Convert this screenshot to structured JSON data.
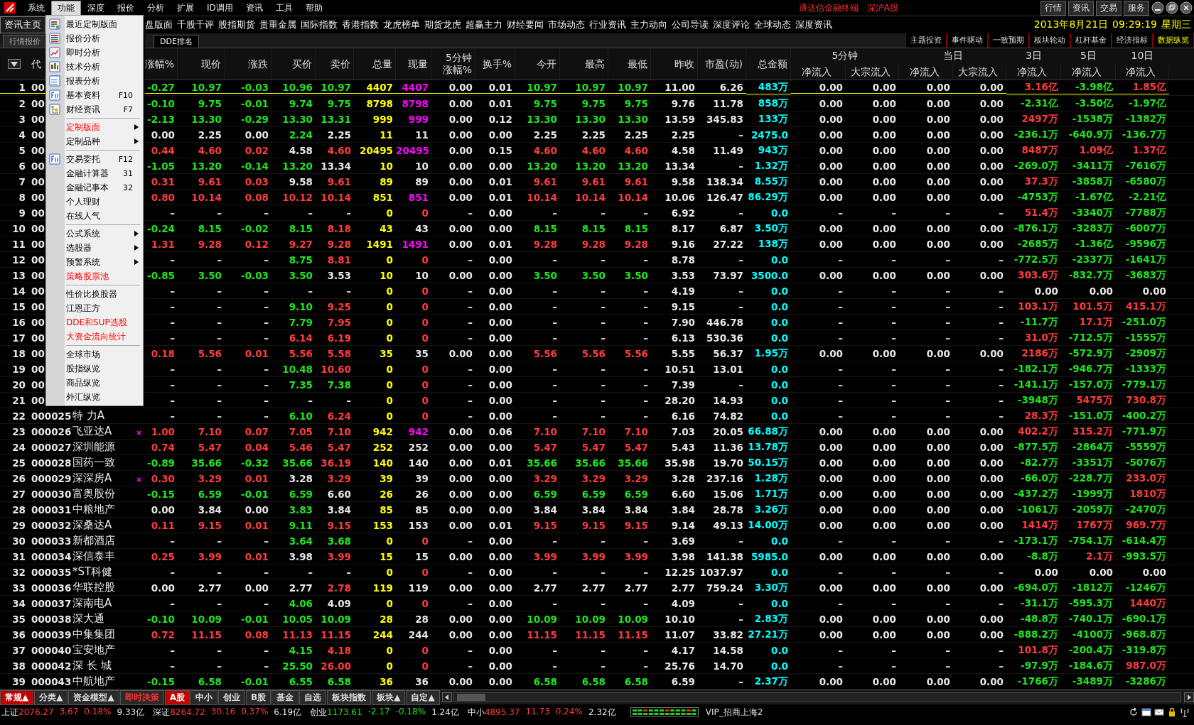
{
  "menubar": {
    "items": [
      {
        "label": "系统",
        "selected": false
      },
      {
        "label": "功能",
        "selected": true
      },
      {
        "label": "深度",
        "selected": false
      },
      {
        "label": "报价",
        "selected": false
      },
      {
        "label": "分析",
        "selected": false
      },
      {
        "label": "扩展",
        "selected": false
      },
      {
        "label": "ID调用",
        "selected": false
      },
      {
        "label": "资讯",
        "selected": false
      },
      {
        "label": "工具",
        "selected": false
      },
      {
        "label": "帮助",
        "selected": false
      }
    ],
    "title": "通达信金融终端",
    "market": "深沪A股",
    "buttons": [
      "行情",
      "资讯",
      "交易",
      "服务"
    ]
  },
  "linkbar": {
    "home_tab": "资讯主页",
    "links": [
      "盘版面",
      "千股千评",
      "股指期货",
      "贵重金属",
      "国际指数",
      "香港指数",
      "龙虎榜单",
      "期货龙虎",
      "超赢主力",
      "财经要闻",
      "市场动态",
      "行业资讯",
      "主力动向",
      "公司导读",
      "深度评论",
      "全球动态",
      "深度资讯"
    ],
    "date": "2013年8月21日",
    "time": "09:29:19",
    "weekday": "星期三"
  },
  "tabbar": {
    "tabs": [
      {
        "label": "行情报价",
        "selected": false
      },
      {
        "label": "DDE排名",
        "selected": true
      }
    ],
    "buttons": [
      {
        "label": "主题投资",
        "selected": false
      },
      {
        "label": "事件驱动",
        "selected": false
      },
      {
        "label": "一致预期",
        "selected": false
      },
      {
        "label": "板块轮动",
        "selected": false
      },
      {
        "label": "杠杆基金",
        "selected": false
      },
      {
        "label": "经济指标",
        "selected": false
      },
      {
        "label": "数据纵览",
        "selected": true
      }
    ]
  },
  "menu": {
    "sections": [
      [
        {
          "label": "最近定制版面",
          "highlight": false,
          "submenu": false
        },
        {
          "label": "报价分析",
          "highlight": false,
          "submenu": false
        },
        {
          "label": "即时分析",
          "highlight": false,
          "submenu": false
        },
        {
          "label": "技术分析",
          "highlight": false,
          "submenu": false
        },
        {
          "label": "报表分析",
          "highlight": false,
          "submenu": false
        },
        {
          "label": "基本资料",
          "shortcut": "F10",
          "highlight": false,
          "submenu": false
        },
        {
          "label": "财经资讯",
          "shortcut": "F7",
          "highlight": false,
          "submenu": false
        }
      ],
      [
        {
          "label": "定制版面",
          "highlight": true,
          "submenu": true
        },
        {
          "label": "定制品种",
          "highlight": false,
          "submenu": true
        }
      ],
      [
        {
          "label": "交易委托",
          "shortcut": "F12",
          "highlight": false,
          "submenu": false
        },
        {
          "label": "金融计算器",
          "shortcut": "31",
          "highlight": false,
          "submenu": false
        },
        {
          "label": "金融记事本",
          "shortcut": "32",
          "highlight": false,
          "submenu": false
        },
        {
          "label": "个人理财",
          "highlight": false,
          "submenu": false
        },
        {
          "label": "在线人气",
          "highlight": false,
          "submenu": false
        }
      ],
      [
        {
          "label": "公式系统",
          "highlight": false,
          "submenu": true
        },
        {
          "label": "选股器",
          "highlight": false,
          "submenu": true
        },
        {
          "label": "预警系统",
          "highlight": false,
          "submenu": true
        },
        {
          "label": "策略股票池",
          "highlight": true,
          "submenu": false
        }
      ],
      [
        {
          "label": "性价比换股器",
          "highlight": false,
          "submenu": false
        },
        {
          "label": "江恩正方",
          "highlight": false,
          "submenu": false
        },
        {
          "label": "DDE和SUP选股",
          "highlight": true,
          "submenu": false
        },
        {
          "label": "大资金流向统计",
          "highlight": true,
          "submenu": false
        }
      ],
      [
        {
          "label": "全球市场",
          "highlight": false,
          "submenu": false
        },
        {
          "label": "股指纵览",
          "highlight": false,
          "submenu": false
        },
        {
          "label": "商品纵览",
          "highlight": false,
          "submenu": false
        },
        {
          "label": "外汇纵览",
          "highlight": false,
          "submenu": false
        }
      ]
    ]
  },
  "table": {
    "code_header": "代",
    "columns": [
      {
        "lines": [
          "涨幅%"
        ]
      },
      {
        "lines": [
          "现价"
        ]
      },
      {
        "lines": [
          "涨跌"
        ]
      },
      {
        "lines": [
          "买价"
        ]
      },
      {
        "lines": [
          "卖价"
        ]
      },
      {
        "lines": [
          "总量"
        ]
      },
      {
        "lines": [
          "现量"
        ]
      },
      {
        "lines": [
          "5分钟",
          "涨幅%"
        ]
      },
      {
        "lines": [
          "换手%"
        ]
      },
      {
        "lines": [
          "今开"
        ]
      },
      {
        "lines": [
          "最高"
        ]
      },
      {
        "lines": [
          "最低"
        ]
      },
      {
        "lines": [
          "昨收"
        ]
      },
      {
        "lines": [
          "市盈(动)"
        ]
      },
      {
        "lines": [
          "总金额"
        ]
      },
      {
        "group": "5分钟",
        "lines": [
          "净流入"
        ]
      },
      {
        "in_group": true,
        "lines": [
          "大宗流入"
        ]
      },
      {
        "group": "当日",
        "lines": [
          "净流入"
        ]
      },
      {
        "in_group": true,
        "lines": [
          "大宗流入"
        ]
      },
      {
        "group": "3日",
        "lines": [
          "净流入"
        ]
      },
      {
        "group": "5日",
        "lines": [
          "净流入"
        ]
      },
      {
        "group": "10日",
        "lines": [
          "净流入"
        ]
      }
    ],
    "rows": [
      {
        "no": "1",
        "code": "00",
        "selected": true,
        "big_buy": true,
        "cells": [
          "-0.27",
          "10.97",
          "-0.03",
          "10.96",
          "10.97",
          "4407",
          "4407",
          "0.00",
          "0.01",
          "10.97",
          "10.97",
          "10.97",
          "11.00",
          "6.26",
          "483万",
          "0.00",
          "0.00",
          "0.00",
          "0.00",
          "3.16亿",
          "-3.98亿",
          "1.85亿"
        ]
      },
      {
        "no": "2",
        "code": "00",
        "selected": false,
        "big_buy": true,
        "cells": [
          "-0.10",
          "9.75",
          "-0.01",
          "9.74",
          "9.75",
          "8798",
          "8798",
          "0.00",
          "0.01",
          "9.75",
          "9.75",
          "9.75",
          "9.76",
          "11.78",
          "858万",
          "0.00",
          "0.00",
          "0.00",
          "0.00",
          "-2.31亿",
          "-3.50亿",
          "-1.97亿"
        ]
      },
      {
        "no": "3",
        "code": "00",
        "selected": false,
        "big_buy": true,
        "cells": [
          "-2.13",
          "13.30",
          "-0.29",
          "13.30",
          "13.31",
          "999",
          "999",
          "0.00",
          "0.12",
          "13.30",
          "13.30",
          "13.30",
          "13.59",
          "345.83",
          "133万",
          "0.00",
          "0.00",
          "0.00",
          "0.00",
          "2497万",
          "-1538万",
          "-1382万"
        ]
      },
      {
        "no": "4",
        "code": "00",
        "selected": false,
        "big_buy": false,
        "cells": [
          "0.00",
          "2.25",
          "0.00",
          "2.24",
          "2.25",
          "11",
          "11",
          "0.00",
          "0.00",
          "2.25",
          "2.25",
          "2.25",
          "2.25",
          "–",
          "2475.0",
          "0.00",
          "0.00",
          "0.00",
          "0.00",
          "-236.1万",
          "-640.9万",
          "-136.7万"
        ]
      },
      {
        "no": "5",
        "code": "00",
        "selected": false,
        "big_buy": true,
        "cells": [
          "0.44",
          "4.60",
          "0.02",
          "4.58",
          "4.60",
          "20495",
          "20495",
          "0.00",
          "0.15",
          "4.60",
          "4.60",
          "4.60",
          "4.58",
          "11.49",
          "943万",
          "0.00",
          "0.00",
          "0.00",
          "0.00",
          "8487万",
          "1.09亿",
          "1.37亿"
        ]
      },
      {
        "no": "6",
        "code": "00",
        "selected": false,
        "big_buy": false,
        "cells": [
          "-1.05",
          "13.20",
          "-0.14",
          "13.20",
          "13.34",
          "10",
          "10",
          "0.00",
          "0.00",
          "13.20",
          "13.20",
          "13.20",
          "13.34",
          "–",
          "1.32万",
          "0.00",
          "0.00",
          "0.00",
          "0.00",
          "-269.0万",
          "-3411万",
          "-7616万"
        ]
      },
      {
        "no": "7",
        "code": "00",
        "selected": false,
        "big_buy": false,
        "cells": [
          "0.31",
          "9.61",
          "0.03",
          "9.58",
          "9.61",
          "89",
          "89",
          "0.00",
          "0.01",
          "9.61",
          "9.61",
          "9.61",
          "9.58",
          "138.34",
          "8.55万",
          "0.00",
          "0.00",
          "0.00",
          "0.00",
          "37.3万",
          "-3858万",
          "-6580万"
        ]
      },
      {
        "no": "8",
        "code": "00",
        "selected": false,
        "big_buy": true,
        "cells": [
          "0.80",
          "10.14",
          "0.08",
          "10.12",
          "10.14",
          "851",
          "851",
          "0.00",
          "0.01",
          "10.14",
          "10.14",
          "10.14",
          "10.06",
          "126.47",
          "86.29万",
          "0.00",
          "0.00",
          "0.00",
          "0.00",
          "-4753万",
          "-1.67亿",
          "-2.21亿"
        ]
      },
      {
        "no": "9",
        "code": "00",
        "selected": false,
        "big_buy": false,
        "cells": [
          "–",
          "–",
          "–",
          "–",
          "–",
          "0",
          "0",
          "–",
          "0.00",
          "–",
          "–",
          "–",
          "6.92",
          "–",
          "0.0",
          "–",
          "–",
          "–",
          "–",
          "51.4万",
          "-3340万",
          "-7788万"
        ]
      },
      {
        "no": "10",
        "code": "00",
        "selected": false,
        "big_buy": false,
        "cells": [
          "-0.24",
          "8.15",
          "-0.02",
          "8.15",
          "8.18",
          "43",
          "43",
          "0.00",
          "0.00",
          "8.15",
          "8.15",
          "8.15",
          "8.17",
          "6.87",
          "3.50万",
          "0.00",
          "0.00",
          "0.00",
          "0.00",
          "-876.1万",
          "-3283万",
          "-6007万"
        ]
      },
      {
        "no": "11",
        "code": "00",
        "selected": false,
        "big_buy": true,
        "cells": [
          "1.31",
          "9.28",
          "0.12",
          "9.27",
          "9.28",
          "1491",
          "1491",
          "0.00",
          "0.01",
          "9.28",
          "9.28",
          "9.28",
          "9.16",
          "27.22",
          "138万",
          "0.00",
          "0.00",
          "0.00",
          "0.00",
          "-2685万",
          "-1.36亿",
          "-9596万"
        ]
      },
      {
        "no": "12",
        "code": "00",
        "selected": false,
        "big_buy": false,
        "cells": [
          "–",
          "–",
          "–",
          "8.75",
          "8.81",
          "0",
          "0",
          "–",
          "0.00",
          "–",
          "–",
          "–",
          "8.78",
          "–",
          "0.0",
          "–",
          "–",
          "–",
          "–",
          "-772.5万",
          "-2337万",
          "-1641万"
        ]
      },
      {
        "no": "13",
        "code": "00",
        "selected": false,
        "big_buy": false,
        "cells": [
          "-0.85",
          "3.50",
          "-0.03",
          "3.50",
          "3.53",
          "10",
          "10",
          "0.00",
          "0.00",
          "3.50",
          "3.50",
          "3.50",
          "3.53",
          "73.97",
          "3500.0",
          "0.00",
          "0.00",
          "0.00",
          "0.00",
          "303.6万",
          "-832.7万",
          "-3683万"
        ]
      },
      {
        "no": "14",
        "code": "00",
        "selected": false,
        "big_buy": false,
        "cells": [
          "–",
          "–",
          "–",
          "–",
          "–",
          "0",
          "0",
          "–",
          "0.00",
          "–",
          "–",
          "–",
          "4.19",
          "–",
          "0.0",
          "–",
          "–",
          "–",
          "–",
          "0.00",
          "0.00",
          "0.00"
        ]
      },
      {
        "no": "15",
        "code": "00",
        "selected": false,
        "big_buy": false,
        "cells": [
          "–",
          "–",
          "–",
          "9.10",
          "9.25",
          "0",
          "0",
          "–",
          "0.00",
          "–",
          "–",
          "–",
          "9.15",
          "–",
          "0.0",
          "–",
          "–",
          "–",
          "–",
          "103.1万",
          "101.5万",
          "415.1万"
        ]
      },
      {
        "no": "16",
        "code": "00",
        "selected": false,
        "big_buy": false,
        "cells": [
          "–",
          "–",
          "–",
          "7.79",
          "7.95",
          "0",
          "0",
          "–",
          "0.00",
          "–",
          "–",
          "–",
          "7.90",
          "446.78",
          "0.0",
          "–",
          "–",
          "–",
          "–",
          "-11.7万",
          "17.1万",
          "-251.0万"
        ]
      },
      {
        "no": "17",
        "code": "00",
        "selected": false,
        "big_buy": false,
        "cells": [
          "–",
          "–",
          "–",
          "6.14",
          "6.19",
          "0",
          "0",
          "–",
          "0.00",
          "–",
          "–",
          "–",
          "6.13",
          "530.36",
          "0.0",
          "–",
          "–",
          "–",
          "–",
          "31.0万",
          "-712.5万",
          "-1555万"
        ]
      },
      {
        "no": "18",
        "code": "00",
        "selected": false,
        "big_buy": false,
        "cells": [
          "0.18",
          "5.56",
          "0.01",
          "5.56",
          "5.58",
          "35",
          "35",
          "0.00",
          "0.00",
          "5.56",
          "5.56",
          "5.56",
          "5.55",
          "56.37",
          "1.95万",
          "0.00",
          "0.00",
          "0.00",
          "0.00",
          "2186万",
          "-572.9万",
          "-2909万"
        ]
      },
      {
        "no": "19",
        "code": "00",
        "selected": false,
        "big_buy": false,
        "cells": [
          "–",
          "–",
          "–",
          "10.48",
          "10.60",
          "0",
          "0",
          "–",
          "0.00",
          "–",
          "–",
          "–",
          "10.51",
          "13.01",
          "0.0",
          "–",
          "–",
          "–",
          "–",
          "-182.1万",
          "-946.7万",
          "-1333万"
        ]
      },
      {
        "no": "20",
        "code": "00",
        "selected": false,
        "big_buy": false,
        "cells": [
          "–",
          "–",
          "–",
          "7.35",
          "7.38",
          "0",
          "0",
          "–",
          "0.00",
          "–",
          "–",
          "–",
          "7.39",
          "–",
          "0.0",
          "–",
          "–",
          "–",
          "–",
          "-141.1万",
          "-157.0万",
          "-779.1万"
        ]
      },
      {
        "no": "21",
        "code": "00",
        "selected": false,
        "big_buy": false,
        "cells": [
          "–",
          "–",
          "–",
          "–",
          "–",
          "0",
          "0",
          "–",
          "0.00",
          "–",
          "–",
          "–",
          "28.20",
          "14.93",
          "0.0",
          "–",
          "–",
          "–",
          "–",
          "-3948万",
          "5475万",
          "730.8万"
        ]
      },
      {
        "no": "22",
        "code": "000025",
        "name": "特 力A",
        "selected": false,
        "big_buy": false,
        "marked": false,
        "cells": [
          "–",
          "–",
          "–",
          "6.10",
          "6.24",
          "0",
          "0",
          "–",
          "0.00",
          "–",
          "–",
          "–",
          "6.16",
          "74.82",
          "0.0",
          "–",
          "–",
          "–",
          "–",
          "28.3万",
          "-151.0万",
          "-400.2万"
        ]
      },
      {
        "no": "23",
        "code": "000026",
        "name": "飞亚达A",
        "selected": false,
        "big_buy": true,
        "marked": true,
        "cells": [
          "1.00",
          "7.10",
          "0.07",
          "7.05",
          "7.10",
          "942",
          "942",
          "0.00",
          "0.06",
          "7.10",
          "7.10",
          "7.10",
          "7.03",
          "20.05",
          "66.88万",
          "0.00",
          "0.00",
          "0.00",
          "0.00",
          "402.2万",
          "315.2万",
          "-771.9万"
        ]
      },
      {
        "no": "24",
        "code": "000027",
        "name": "深圳能源",
        "selected": false,
        "big_buy": false,
        "marked": false,
        "cells": [
          "0.74",
          "5.47",
          "0.04",
          "5.46",
          "5.47",
          "252",
          "252",
          "0.00",
          "0.00",
          "5.47",
          "5.47",
          "5.47",
          "5.43",
          "11.36",
          "13.78万",
          "0.00",
          "0.00",
          "0.00",
          "0.00",
          "-877.5万",
          "-2864万",
          "-5559万"
        ]
      },
      {
        "no": "25",
        "code": "000028",
        "name": "国药一致",
        "selected": false,
        "big_buy": false,
        "marked": false,
        "cells": [
          "-0.89",
          "35.66",
          "-0.32",
          "35.66",
          "36.19",
          "140",
          "140",
          "0.00",
          "0.01",
          "35.66",
          "35.66",
          "35.66",
          "35.98",
          "19.70",
          "50.15万",
          "0.00",
          "0.00",
          "0.00",
          "0.00",
          "-82.7万",
          "-3351万",
          "-5076万"
        ]
      },
      {
        "no": "26",
        "code": "000029",
        "name": "深深房A",
        "selected": false,
        "big_buy": false,
        "marked": true,
        "cells": [
          "0.30",
          "3.29",
          "0.01",
          "3.28",
          "3.29",
          "39",
          "39",
          "0.00",
          "0.00",
          "3.29",
          "3.29",
          "3.29",
          "3.28",
          "237.16",
          "1.28万",
          "0.00",
          "0.00",
          "0.00",
          "0.00",
          "-66.0万",
          "-228.7万",
          "233.0万"
        ]
      },
      {
        "no": "27",
        "code": "000030",
        "name": "富奥股份",
        "selected": false,
        "big_buy": false,
        "marked": false,
        "cells": [
          "-0.15",
          "6.59",
          "-0.01",
          "6.59",
          "6.60",
          "26",
          "26",
          "0.00",
          "0.00",
          "6.59",
          "6.59",
          "6.59",
          "6.60",
          "15.06",
          "1.71万",
          "0.00",
          "0.00",
          "0.00",
          "0.00",
          "-437.2万",
          "-1999万",
          "1810万"
        ]
      },
      {
        "no": "28",
        "code": "000031",
        "name": "中粮地产",
        "selected": false,
        "big_buy": false,
        "marked": false,
        "cells": [
          "0.00",
          "3.84",
          "0.00",
          "3.83",
          "3.84",
          "85",
          "85",
          "0.00",
          "0.00",
          "3.84",
          "3.84",
          "3.84",
          "3.84",
          "28.78",
          "3.26万",
          "0.00",
          "0.00",
          "0.00",
          "0.00",
          "-1061万",
          "-2059万",
          "-2470万"
        ]
      },
      {
        "no": "29",
        "code": "000032",
        "name": "深桑达A",
        "selected": false,
        "big_buy": false,
        "marked": false,
        "cells": [
          "0.11",
          "9.15",
          "0.01",
          "9.11",
          "9.15",
          "153",
          "153",
          "0.00",
          "0.01",
          "9.15",
          "9.15",
          "9.15",
          "9.14",
          "49.13",
          "14.00万",
          "0.00",
          "0.00",
          "0.00",
          "0.00",
          "1414万",
          "1767万",
          "969.7万"
        ]
      },
      {
        "no": "30",
        "code": "000033",
        "name": "新都酒店",
        "selected": false,
        "big_buy": false,
        "marked": false,
        "cells": [
          "–",
          "–",
          "–",
          "3.64",
          "3.68",
          "0",
          "0",
          "–",
          "0.00",
          "–",
          "–",
          "–",
          "3.69",
          "–",
          "0.0",
          "–",
          "–",
          "–",
          "–",
          "-173.1万",
          "-754.1万",
          "-614.4万"
        ]
      },
      {
        "no": "31",
        "code": "000034",
        "name": "深信泰丰",
        "selected": false,
        "big_buy": false,
        "marked": false,
        "cells": [
          "0.25",
          "3.99",
          "0.01",
          "3.98",
          "3.99",
          "15",
          "15",
          "0.00",
          "0.00",
          "3.99",
          "3.99",
          "3.99",
          "3.98",
          "141.38",
          "5985.0",
          "0.00",
          "0.00",
          "0.00",
          "0.00",
          "-8.8万",
          "2.1万",
          "-993.5万"
        ]
      },
      {
        "no": "32",
        "code": "000035",
        "name": "*ST科健",
        "selected": false,
        "big_buy": false,
        "marked": false,
        "cells": [
          "–",
          "–",
          "–",
          "–",
          "–",
          "0",
          "0",
          "–",
          "0.00",
          "–",
          "–",
          "–",
          "12.25",
          "1037.97",
          "0.0",
          "–",
          "–",
          "–",
          "–",
          "0.00",
          "0.00",
          "0.00"
        ]
      },
      {
        "no": "33",
        "code": "000036",
        "name": "华联控股",
        "selected": false,
        "big_buy": false,
        "marked": false,
        "cells": [
          "0.00",
          "2.77",
          "0.00",
          "2.77",
          "2.78",
          "119",
          "119",
          "0.00",
          "0.00",
          "2.77",
          "2.77",
          "2.77",
          "2.77",
          "759.24",
          "3.30万",
          "0.00",
          "0.00",
          "0.00",
          "0.00",
          "-694.0万",
          "-1812万",
          "-1246万"
        ]
      },
      {
        "no": "34",
        "code": "000037",
        "name": "深南电A",
        "selected": false,
        "big_buy": false,
        "marked": false,
        "cells": [
          "–",
          "–",
          "–",
          "4.06",
          "4.09",
          "0",
          "0",
          "–",
          "0.00",
          "–",
          "–",
          "–",
          "4.09",
          "–",
          "0.0",
          "–",
          "–",
          "–",
          "–",
          "-31.1万",
          "-595.3万",
          "1440万"
        ]
      },
      {
        "no": "35",
        "code": "000038",
        "name": "深大通",
        "selected": false,
        "big_buy": false,
        "marked": false,
        "cells": [
          "-0.10",
          "10.09",
          "-0.01",
          "10.05",
          "10.09",
          "28",
          "28",
          "0.00",
          "0.00",
          "10.09",
          "10.09",
          "10.09",
          "10.10",
          "–",
          "2.83万",
          "0.00",
          "0.00",
          "0.00",
          "0.00",
          "-48.8万",
          "-740.1万",
          "-690.1万"
        ]
      },
      {
        "no": "36",
        "code": "000039",
        "name": "中集集团",
        "selected": false,
        "big_buy": false,
        "marked": false,
        "cells": [
          "0.72",
          "11.15",
          "0.08",
          "11.13",
          "11.15",
          "244",
          "244",
          "0.00",
          "0.00",
          "11.15",
          "11.15",
          "11.15",
          "11.07",
          "33.82",
          "27.21万",
          "0.00",
          "0.00",
          "0.00",
          "0.00",
          "-888.2万",
          "-4100万",
          "-968.8万"
        ]
      },
      {
        "no": "37",
        "code": "000040",
        "name": "宝安地产",
        "selected": false,
        "big_buy": false,
        "marked": false,
        "cells": [
          "–",
          "–",
          "–",
          "4.15",
          "4.18",
          "0",
          "0",
          "–",
          "0.00",
          "–",
          "–",
          "–",
          "4.17",
          "14.58",
          "0.0",
          "–",
          "–",
          "–",
          "–",
          "101.8万",
          "-200.4万",
          "-319.8万"
        ]
      },
      {
        "no": "38",
        "code": "000042",
        "name": "深 长 城",
        "selected": false,
        "big_buy": false,
        "marked": false,
        "cells": [
          "–",
          "–",
          "–",
          "25.50",
          "26.00",
          "0",
          "0",
          "–",
          "0.00",
          "–",
          "–",
          "–",
          "25.76",
          "14.70",
          "0.0",
          "–",
          "–",
          "–",
          "–",
          "-97.9万",
          "-184.6万",
          "987.0万"
        ]
      },
      {
        "no": "39",
        "code": "000043",
        "name": "中航地产",
        "selected": false,
        "big_buy": false,
        "marked": false,
        "cells": [
          "-0.15",
          "6.58",
          "-0.01",
          "6.55",
          "6.58",
          "36",
          "36",
          "0.00",
          "0.00",
          "6.58",
          "6.58",
          "6.58",
          "6.59",
          "–",
          "2.37万",
          "0.00",
          "0.00",
          "0.00",
          "0.00",
          "-1766万",
          "-3489万",
          "-3286万"
        ]
      }
    ]
  },
  "bottom_tabs": [
    {
      "label": "常规▲",
      "selected": true,
      "highlight": false
    },
    {
      "label": "分类▲",
      "selected": false,
      "highlight": false
    },
    {
      "label": "资金模型▲",
      "selected": false,
      "highlight": false
    },
    {
      "label": "即时决策",
      "selected": false,
      "highlight": true
    },
    {
      "label": "A股",
      "selected": true,
      "highlight": false
    },
    {
      "label": "中小",
      "selected": false,
      "highlight": false
    },
    {
      "label": "创业",
      "selected": false,
      "highlight": false
    },
    {
      "label": "B股",
      "selected": false,
      "highlight": false
    },
    {
      "label": "基金",
      "selected": false,
      "highlight": false
    },
    {
      "label": "自选",
      "selected": false,
      "highlight": false
    },
    {
      "label": "板块指数",
      "selected": false,
      "highlight": false
    },
    {
      "label": "板块▲",
      "selected": false,
      "highlight": false
    },
    {
      "label": "自定▲",
      "selected": false,
      "highlight": false
    }
  ],
  "status_bar": {
    "indices": [
      {
        "name": "上证",
        "value": "2076.27",
        "change": "3.67",
        "percent": "0.18%",
        "amount": "9.33亿"
      },
      {
        "name": "深证",
        "value": "8264.72",
        "change": "30.16",
        "percent": "0.37%",
        "amount": "6.19亿"
      },
      {
        "name": "创业",
        "value": "1173.61",
        "change": "-2.17",
        "percent": "-0.18%",
        "amount": "1.24亿"
      },
      {
        "name": "中小",
        "value": "4895.37",
        "change": "11.73",
        "percent": "0.24%",
        "amount": "2.32亿"
      }
    ],
    "server": "VIP_招商上海2"
  }
}
